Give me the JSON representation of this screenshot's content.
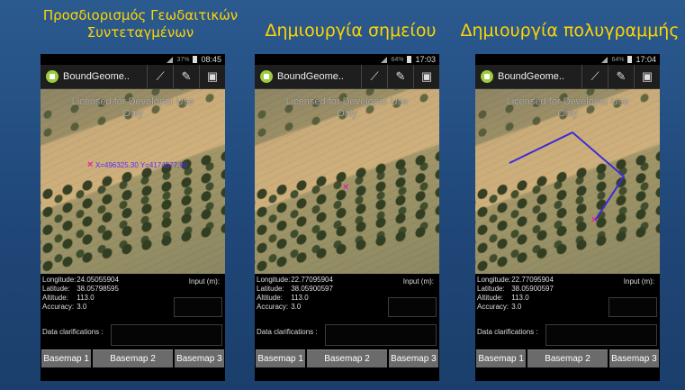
{
  "titles": [
    "Προσδιορισμός Γεωδαιτικών Συντεταγμένων",
    "Δημιουργία σημείου",
    "Δημιουργία πολυγραμμής"
  ],
  "colors": {
    "background": "#244a7a",
    "title": "#ffd400",
    "marker": "#e81da8",
    "polyline": "#3a2bd8"
  },
  "phones": [
    {
      "status": {
        "battery": "37%",
        "time": "08:45"
      },
      "app_name": "BoundGeome..",
      "watermark": "Licensed for Developer Use Only",
      "coords_label": "X=496325,30  Y=4174577,90",
      "longitude_label": "Longitude:",
      "longitude": "24.05055904",
      "latitude_label": "Latitude:",
      "latitude": "38.05798595",
      "altitude_label": "Altitude:",
      "altitude": "113.0",
      "accuracy_label": "Accuracy:",
      "accuracy": "3.0",
      "input_label": "Input (m):",
      "clarifications_label": "Data clarifications :",
      "basemaps": [
        "Basemap 1",
        "Basemap 2",
        "Basemap 3"
      ]
    },
    {
      "status": {
        "battery": "64%",
        "time": "17:03"
      },
      "app_name": "BoundGeome..",
      "watermark": "Licensed for Developer Use Only",
      "longitude_label": "Longitude:",
      "longitude": "22.77095904",
      "latitude_label": "Latitude:",
      "latitude": "38.05900597",
      "altitude_label": "Altitude:",
      "altitude": "113.0",
      "accuracy_label": "Accuracy:",
      "accuracy": "3.0",
      "input_label": "Input (m):",
      "clarifications_label": "Data clarifications :",
      "basemaps": [
        "Basemap 1",
        "Basemap 2",
        "Basemap 3"
      ]
    },
    {
      "status": {
        "battery": "64%",
        "time": "17:04"
      },
      "app_name": "BoundGeome..",
      "watermark": "Licensed for Developer Use Only",
      "longitude_label": "Longitude:",
      "longitude": "22.77095904",
      "latitude_label": "Latitude:",
      "latitude": "38.05900597",
      "altitude_label": "Altitude:",
      "altitude": "113.0",
      "accuracy_label": "Accuracy:",
      "accuracy": "3.0",
      "input_label": "Input (m):",
      "clarifications_label": "Data clarifications :",
      "basemaps": [
        "Basemap 1",
        "Basemap 2",
        "Basemap 3"
      ]
    }
  ],
  "icons": [
    "android-app-icon",
    "measure-tool-icon",
    "pencil-icon",
    "save-icon",
    "signal-icon",
    "battery-icon"
  ],
  "marker_glyph": "×"
}
